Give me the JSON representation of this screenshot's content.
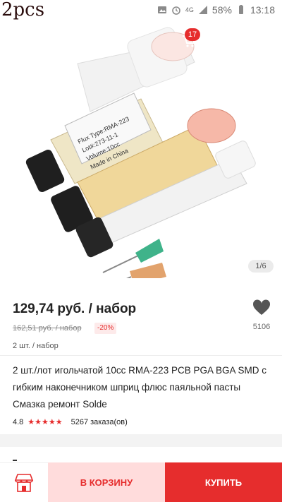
{
  "overlay_label": "2pcs",
  "status_bar": {
    "network": "4G",
    "battery": "58%",
    "time": "13:18"
  },
  "header": {
    "cart_count": "17"
  },
  "gallery": {
    "page_indicator": "1/6",
    "product_label_lines": [
      "Flux Type:RMA-223",
      "Lot#:273-11-1",
      "Volume:10cc",
      "Made in China"
    ]
  },
  "product": {
    "price": "129,74 руб. / набор",
    "old_price": "162,51 руб. / набор",
    "discount": "-20%",
    "unit": "2 шт. / набор",
    "wishlist_count": "5106",
    "title": "2 шт./лот игольчатой 10cc RMA-223 PCB PGA BGA SMD с гибким наконечником шприц флюс паяльной пасты Смазка ремонт Solde",
    "rating": "4.8",
    "stars": "★★★★★",
    "orders": "5267 заказа(ов)"
  },
  "bottom_bar": {
    "add_to_cart": "В КОРЗИНУ",
    "buy": "КУПИТЬ"
  },
  "colors": {
    "accent": "#e62d2d",
    "cart_button_bg": "#ffdcdc"
  }
}
